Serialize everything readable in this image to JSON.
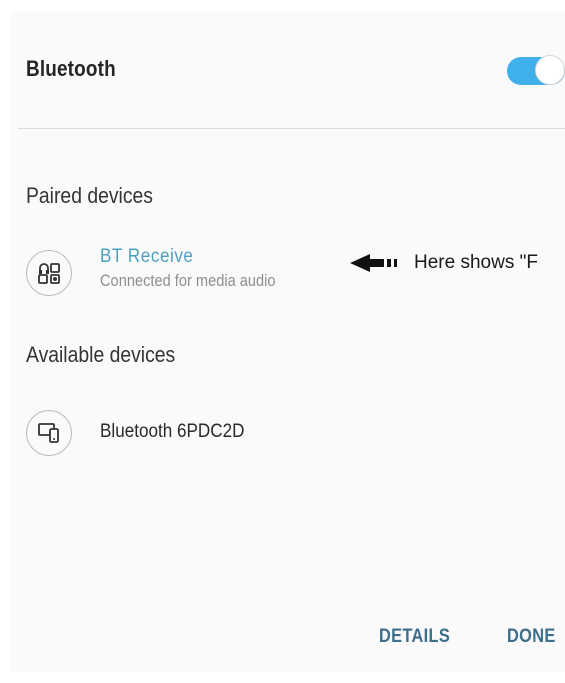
{
  "header": {
    "title": "Bluetooth",
    "toggle_state": "on"
  },
  "paired_section": {
    "title": "Paired devices",
    "devices": [
      {
        "name": "BT Receive",
        "status": "Connected for media audio",
        "icon": "headset-speaker-icon"
      }
    ]
  },
  "available_section": {
    "title": "Available devices",
    "devices": [
      {
        "name": "Bluetooth 6PDC2D",
        "icon": "devices-icon"
      }
    ]
  },
  "annotation": {
    "text": "Here shows \"F"
  },
  "footer": {
    "details_label": "DETAILS",
    "done_label": "DONE"
  },
  "colors": {
    "accent": "#3fb0ea",
    "connected_text": "#4d9fbe",
    "footer_button": "#3d6f8c"
  }
}
